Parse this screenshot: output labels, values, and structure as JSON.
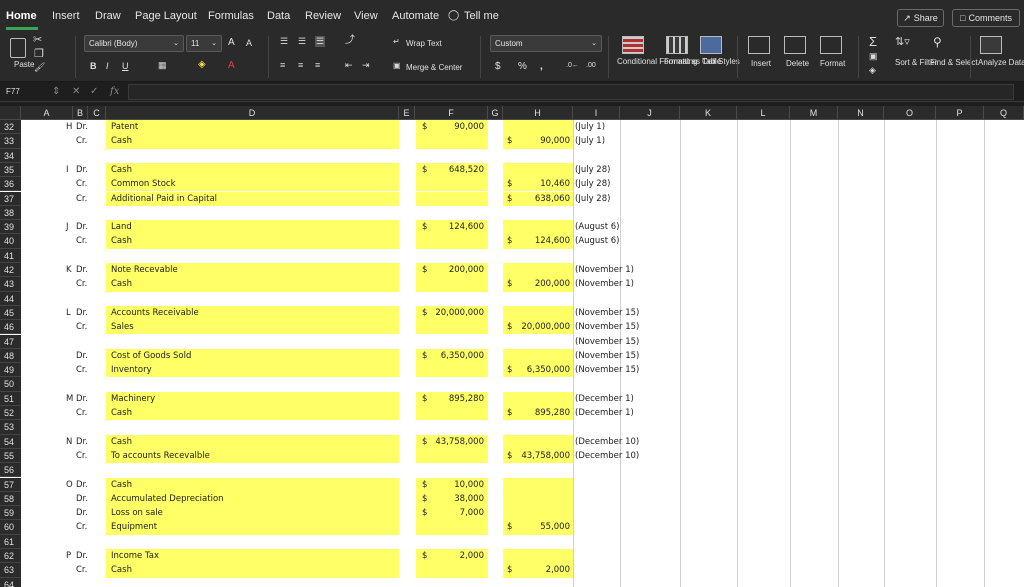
{
  "tabs": [
    "Home",
    "Insert",
    "Draw",
    "Page Layout",
    "Formulas",
    "Data",
    "Review",
    "View",
    "Automate",
    "Tell me"
  ],
  "share_label": "Share",
  "comments_label": "Comments",
  "ribbon": {
    "paste": "Paste",
    "font_name": "Calibri (Body)",
    "font_size": "11",
    "wrap_text": "Wrap Text",
    "merge_center": "Merge & Center",
    "number_format": "Custom",
    "conditional_formatting": "Conditional Formatting",
    "format_as_table": "Format as Table",
    "cell_styles": "Cell Styles",
    "insert": "Insert",
    "delete": "Delete",
    "format": "Format",
    "sort_filter": "Sort & Filter",
    "find_select": "Find & Select",
    "analyze_data": "Analyze Data"
  },
  "formula_bar": {
    "name_box": "F77",
    "fx": "fx"
  },
  "columns": [
    "A",
    "B",
    "C",
    "D",
    "E",
    "F",
    "G",
    "H",
    "I",
    "J",
    "K",
    "L",
    "M",
    "N",
    "O",
    "P",
    "Q"
  ],
  "rows": [
    {
      "n": "32",
      "b": "H",
      "c": "Dr.",
      "d": "Patent",
      "f": "90,000",
      "fd": true,
      "hl": true
    },
    {
      "n": "33",
      "c": "Cr.",
      "d": "Cash",
      "h": "90,000",
      "hd": true,
      "i": "(July 1)",
      "hl": true
    },
    {
      "n": "34"
    },
    {
      "n": "35",
      "b": "I",
      "c": "Dr.",
      "d": "Cash",
      "f": "648,520",
      "fd": true,
      "i": "(July 28)",
      "hl": true
    },
    {
      "n": "36",
      "c": "Cr.",
      "d": "Common Stock",
      "h": "10,460",
      "hd": true,
      "i": "(July 28)",
      "hl": true
    },
    {
      "n": "37",
      "c": "Cr.",
      "d": "Additional Paid in Capital",
      "h": "638,060",
      "hd": true,
      "i": "(July 28)",
      "hl": true
    },
    {
      "n": "38"
    },
    {
      "n": "39",
      "b": "J",
      "c": "Dr.",
      "d": "Land",
      "f": "124,600",
      "fd": true,
      "i": "(August 6)",
      "hl": true
    },
    {
      "n": "40",
      "c": "Cr.",
      "d": "Cash",
      "h": "124,600",
      "hd": true,
      "i": "(August 6)",
      "hl": true
    },
    {
      "n": "41"
    },
    {
      "n": "42",
      "b": "K",
      "c": "Dr.",
      "d": "Note Recevable",
      "f": "200,000",
      "fd": true,
      "i": "(November 1)",
      "hl": true
    },
    {
      "n": "43",
      "c": "Cr.",
      "d": "Cash",
      "h": "200,000",
      "hd": true,
      "i": "(November 1)",
      "hl": true
    },
    {
      "n": "44"
    },
    {
      "n": "45",
      "b": "L",
      "c": "Dr.",
      "d": "Accounts Receivable",
      "f": "20,000,000",
      "fd": true,
      "i": "(November 15)",
      "hl": true
    },
    {
      "n": "46",
      "c": "Cr.",
      "d": "Sales",
      "h": "20,000,000",
      "hd": true,
      "i": "(November 15)",
      "hl": true
    },
    {
      "n": "47",
      "i": "(November 15)"
    },
    {
      "n": "48",
      "c": "Dr.",
      "d": "Cost of Goods Sold",
      "f": "6,350,000",
      "fd": true,
      "i": "(November 15)",
      "hl": true
    },
    {
      "n": "49",
      "c": "Cr.",
      "d": "Inventory",
      "h": "6,350,000",
      "hd": true,
      "i": "(November 15)",
      "hl": true
    },
    {
      "n": "50"
    },
    {
      "n": "51",
      "b": "M",
      "c": "Dr.",
      "d": "Machinery",
      "f": "895,280",
      "fd": true,
      "i": "(December 1)",
      "hl": true
    },
    {
      "n": "52",
      "c": "Cr.",
      "d": "Cash",
      "h": "895,280",
      "hd": true,
      "i": "(December 1)",
      "hl": true
    },
    {
      "n": "53"
    },
    {
      "n": "54",
      "b": "N",
      "c": "Dr.",
      "d": "Cash",
      "f": "43,758,000",
      "fd": true,
      "i": "(December 10)",
      "hl": true
    },
    {
      "n": "55",
      "c": "Cr.",
      "d": "To accounts Recevalble",
      "h": "43,758,000",
      "hd": true,
      "i": "(December 10)",
      "hl": true
    },
    {
      "n": "56"
    },
    {
      "n": "57",
      "b": "O",
      "c": "Dr.",
      "d": "Cash",
      "f": "10,000",
      "fd": true,
      "hl": true
    },
    {
      "n": "58",
      "c": "Dr.",
      "d": "Accumulated Depreciation",
      "f": "38,000",
      "fd": true,
      "hl": true
    },
    {
      "n": "59",
      "c": "Dr.",
      "d": "Loss on sale",
      "f": "7,000",
      "fd": true,
      "hl": true
    },
    {
      "n": "60",
      "c": "Cr.",
      "d": "Equipment",
      "h": "55,000",
      "hd": true,
      "hl": true
    },
    {
      "n": "61"
    },
    {
      "n": "62",
      "b": "P",
      "c": "Dr.",
      "d": "Income Tax",
      "f": "2,000",
      "fd": true,
      "hl": true
    },
    {
      "n": "63",
      "c": "Cr.",
      "d": "Cash",
      "h": "2,000",
      "hd": true,
      "hl": true
    },
    {
      "n": "64"
    }
  ],
  "note_row32_i": "(July 1)",
  "dollar": "$",
  "colors": {
    "highlight": "#ffff66",
    "accent": "#3aa355",
    "chrome": "#2a2a2a"
  }
}
